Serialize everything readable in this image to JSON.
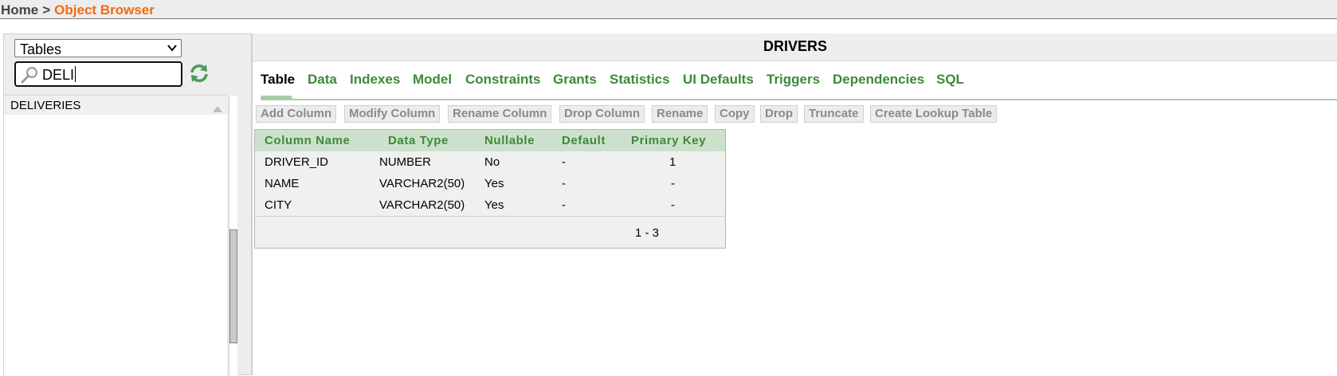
{
  "breadcrumb": {
    "home": "Home",
    "separator": ">",
    "current": "Object Browser"
  },
  "left_panel": {
    "object_type": "Tables",
    "search_value": "DELI",
    "results": [
      "DELIVERIES"
    ]
  },
  "main": {
    "title": "DRIVERS",
    "tabs": [
      "Table",
      "Data",
      "Indexes",
      "Model",
      "Constraints",
      "Grants",
      "Statistics",
      "UI Defaults",
      "Triggers",
      "Dependencies",
      "SQL"
    ],
    "active_tab": "Table",
    "actions": [
      "Add Column",
      "Modify Column",
      "Rename Column",
      "Drop Column",
      "Rename",
      "Copy",
      "Drop",
      "Truncate",
      "Create Lookup Table"
    ],
    "grid": {
      "columns": [
        "Column Name",
        "Data Type",
        "Nullable",
        "Default",
        "Primary Key"
      ],
      "rows": [
        [
          "DRIVER_ID",
          "NUMBER",
          "No",
          "-",
          "1"
        ],
        [
          "NAME",
          "VARCHAR2(50)",
          "Yes",
          "-",
          "-"
        ],
        [
          "CITY",
          "VARCHAR2(50)",
          "Yes",
          "-",
          "-"
        ]
      ],
      "pagination": "1 - 3"
    }
  },
  "colors": {
    "accent_orange": "#f26a10",
    "tab_green": "#3d8a38",
    "header_green_bg": "#cde0cc"
  },
  "icons": {
    "search": "magnifier-icon",
    "refresh": "refresh-icon",
    "select": "chevron-down-icon"
  }
}
